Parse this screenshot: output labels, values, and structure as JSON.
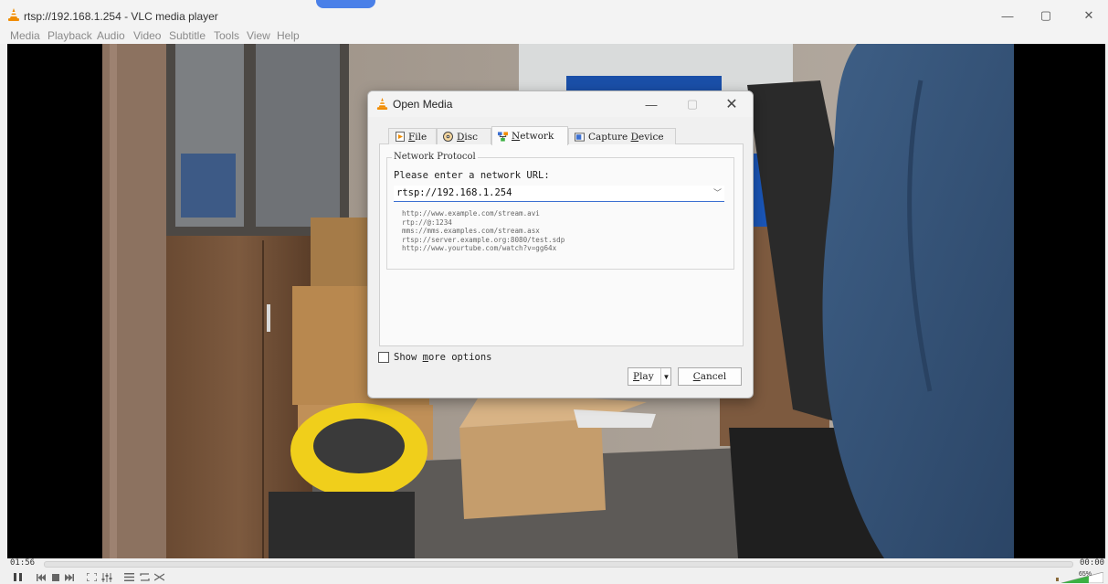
{
  "window": {
    "title": "rtsp://192.168.1.254 - VLC media player",
    "minimize": "—",
    "maximize": "▢",
    "close": "✕"
  },
  "menu": [
    "Media",
    "Playback",
    "Audio",
    "Video",
    "Subtitle",
    "Tools",
    "View",
    "Help"
  ],
  "player": {
    "elapsed": "01:56",
    "remaining": "00:00",
    "volume": "65%",
    "volume_level": 0.65
  },
  "dialog": {
    "title": "Open Media",
    "tabs": [
      {
        "key": "F",
        "rest": "ile",
        "icon": "file-icon"
      },
      {
        "key": "D",
        "rest": "isc",
        "icon": "disc-icon"
      },
      {
        "key": "N",
        "rest": "etwork",
        "icon": "network-icon"
      },
      {
        "key": "",
        "label": "Capture ",
        "key2": "D",
        "rest": "evice",
        "icon": "capture-device-icon"
      }
    ],
    "active_tab": "Network",
    "group_title": "Network Protocol",
    "prompt": "Please enter a network URL:",
    "url_value": "rtsp://192.168.1.254",
    "examples": [
      "http://www.example.com/stream.avi",
      "rtp://@:1234",
      "mms://mms.examples.com/stream.asx",
      "rtsp://server.example.org:8080/test.sdp",
      "http://www.yourtube.com/watch?v=gg64x"
    ],
    "show_more": {
      "pre": "Show ",
      "key": "m",
      "post": "ore options"
    },
    "play": {
      "key": "P",
      "rest": "lay"
    },
    "cancel": {
      "key": "C",
      "rest": "ancel"
    }
  },
  "colors": {
    "accent": "#3b6fd1",
    "vlc_orange": "#f08c00",
    "volume_green": "#3cb043"
  }
}
